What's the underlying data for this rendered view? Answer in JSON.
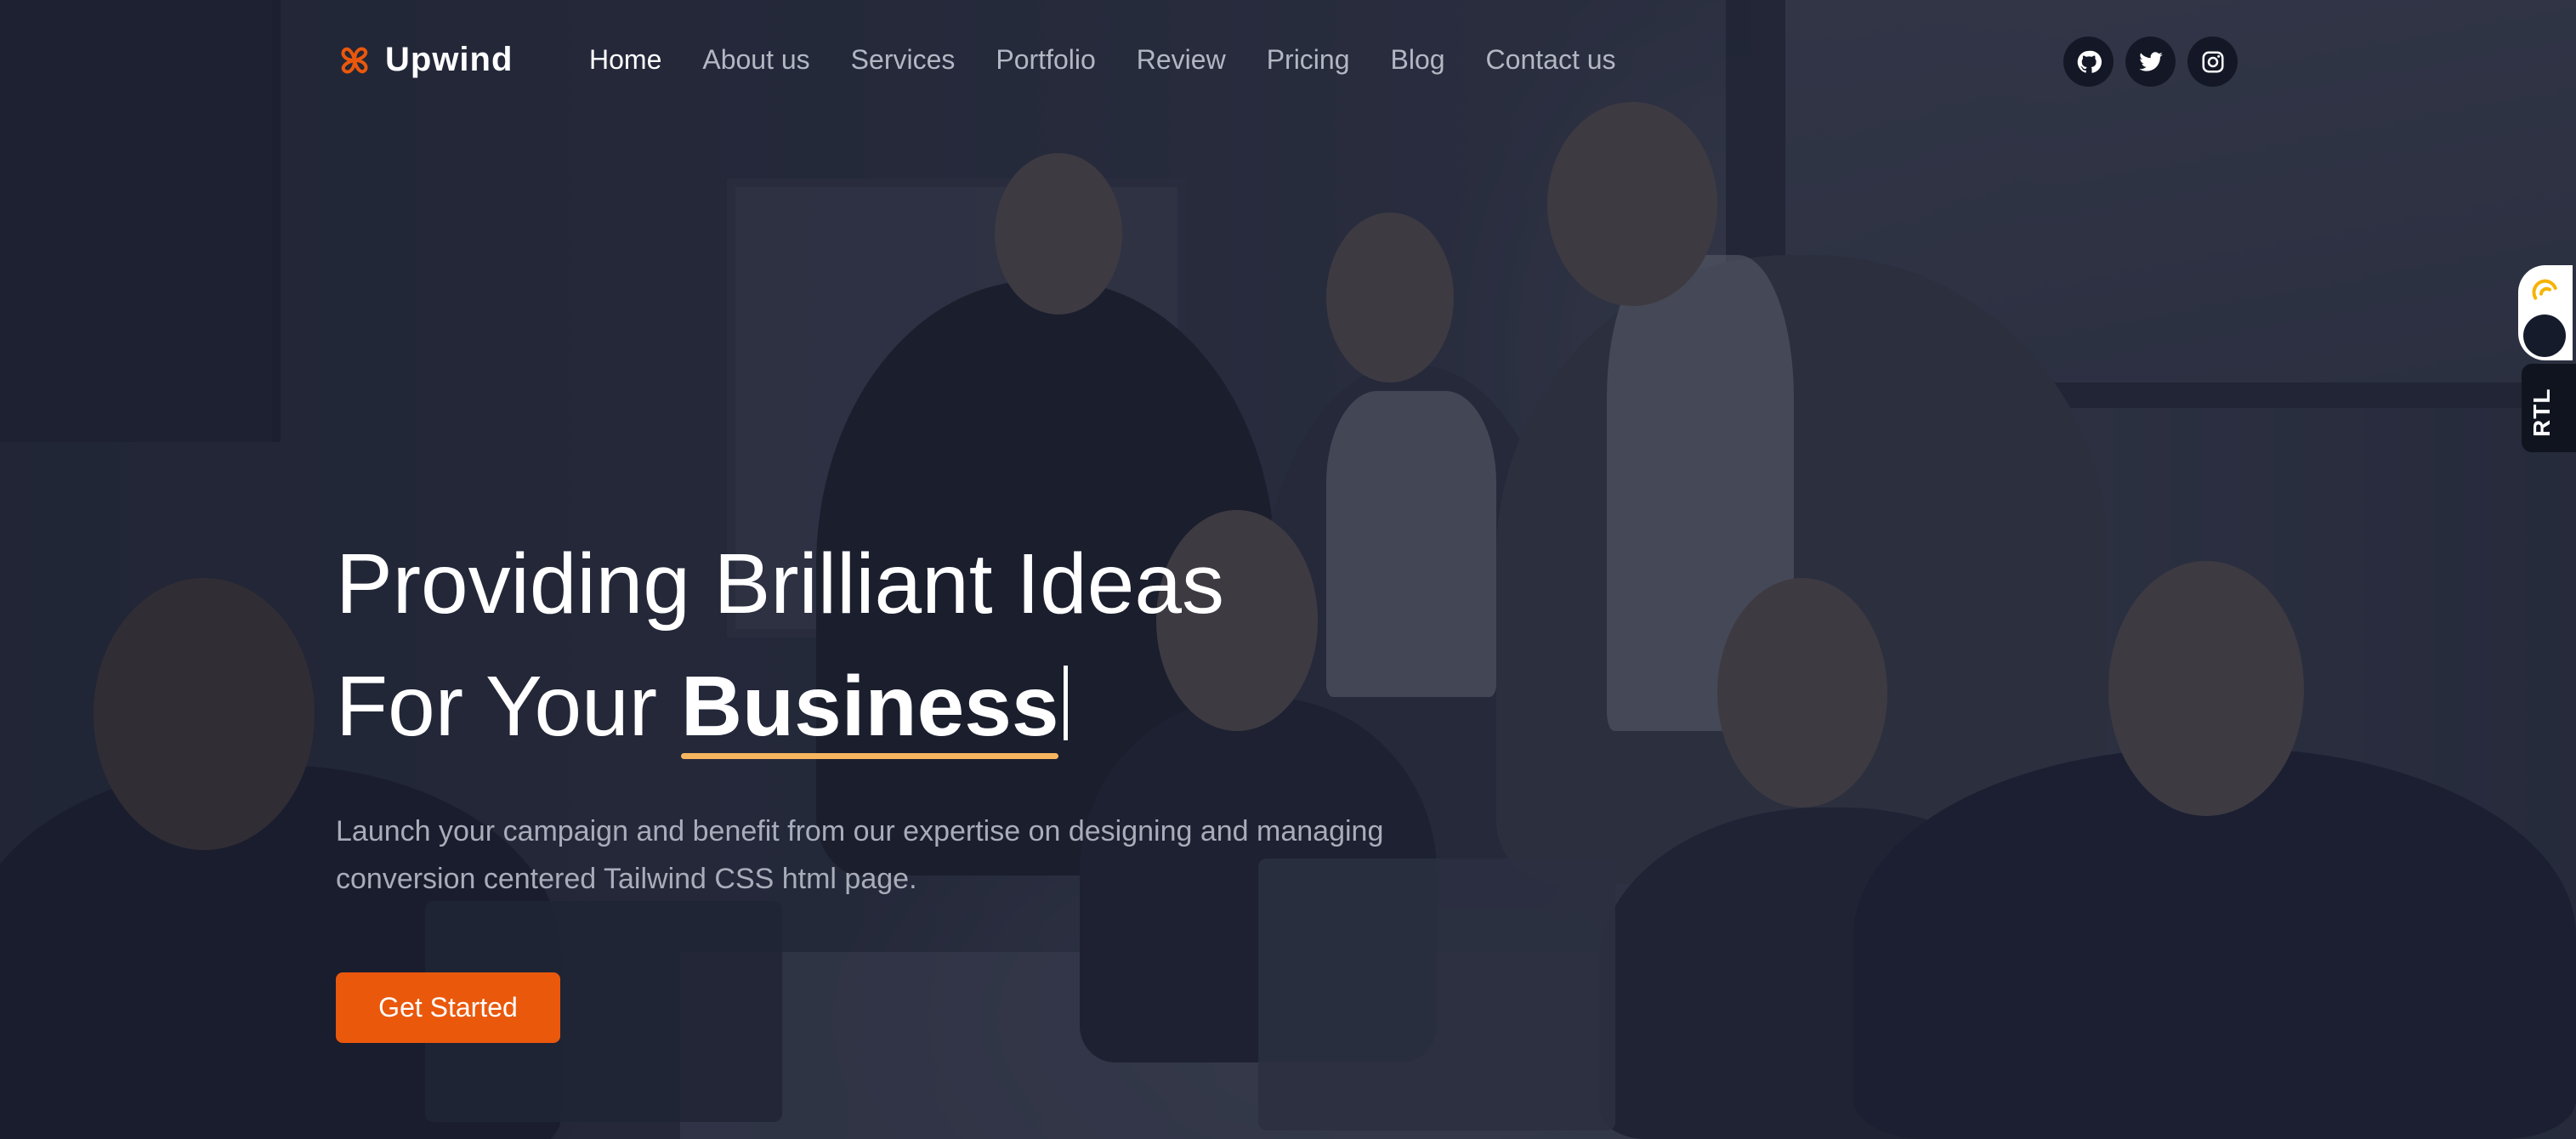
{
  "brand": {
    "name": "Upwind",
    "logo_icon": "pinwheel-icon",
    "accent_color": "#ea580c"
  },
  "nav": {
    "items": [
      {
        "label": "Home",
        "active": true
      },
      {
        "label": "About us",
        "active": false
      },
      {
        "label": "Services",
        "active": false
      },
      {
        "label": "Portfolio",
        "active": false
      },
      {
        "label": "Review",
        "active": false
      },
      {
        "label": "Pricing",
        "active": false
      },
      {
        "label": "Blog",
        "active": false
      },
      {
        "label": "Contact us",
        "active": false
      }
    ]
  },
  "socials": [
    {
      "icon": "github-icon"
    },
    {
      "icon": "twitter-icon"
    },
    {
      "icon": "instagram-icon"
    }
  ],
  "hero": {
    "headline_line1": "Providing Brilliant Ideas",
    "headline_prefix": "For Your",
    "headline_highlight": "Business",
    "highlight_underline_color": "#f7b560",
    "description": "Launch your campaign and benefit from our expertise on designing and managing conversion centered Tailwind CSS html page.",
    "cta_label": "Get Started",
    "cta_color": "#ea580c"
  },
  "settings": {
    "mode_icon": "sun-icon",
    "rtl_label": "RTL"
  }
}
